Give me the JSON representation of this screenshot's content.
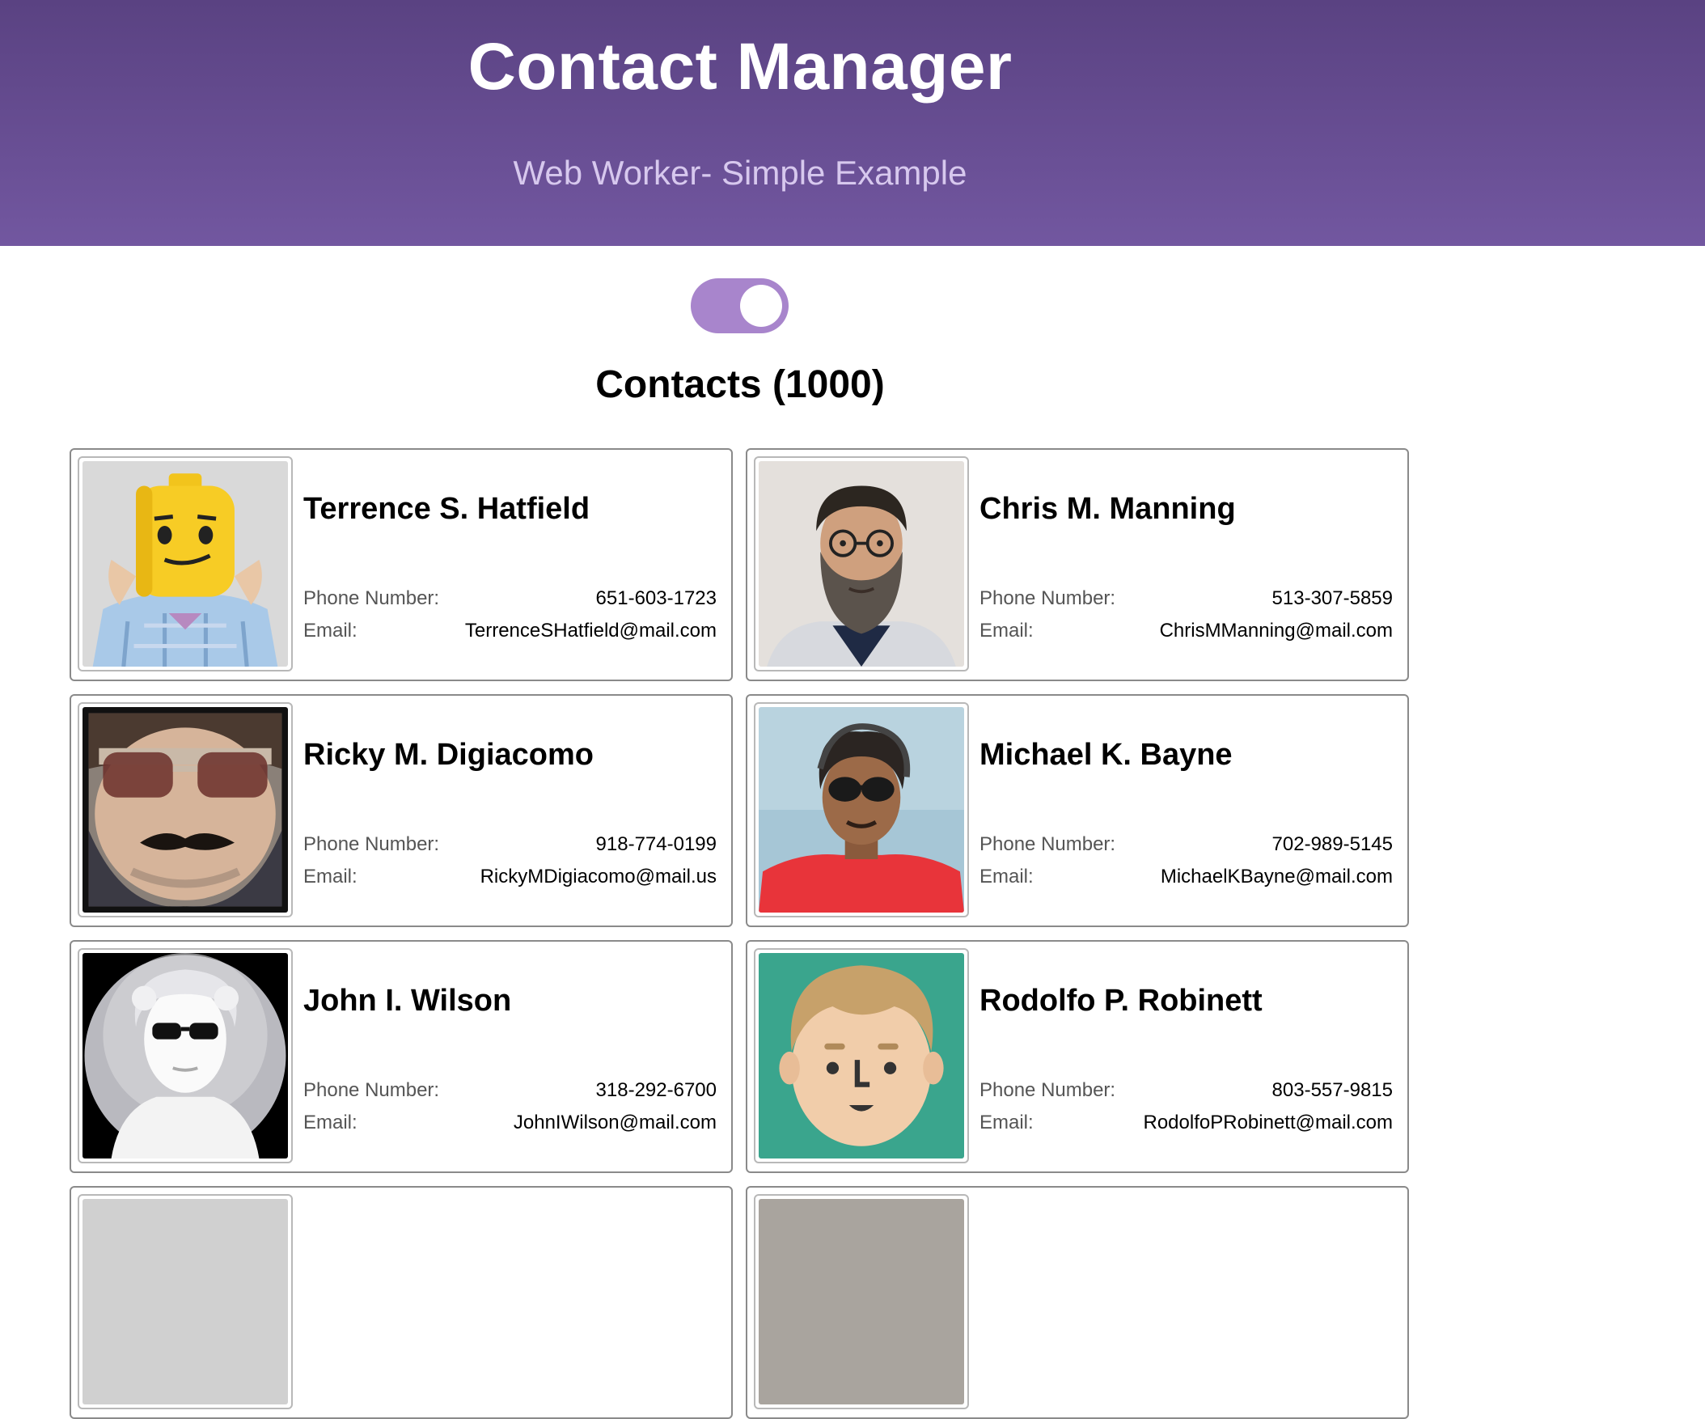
{
  "header": {
    "title": "Contact Manager",
    "subtitle": "Web Worker- Simple Example"
  },
  "toggle": {
    "state": "on",
    "color": "#a885cc"
  },
  "contacts_heading": "Contacts (1000)",
  "labels": {
    "phone": "Phone Number:",
    "email": "Email:"
  },
  "contacts": [
    {
      "name": "Terrence S. Hatfield",
      "phone": "651-603-1723",
      "email": "TerrenceSHatfield@mail.com",
      "avatar": "lego-head-avatar"
    },
    {
      "name": "Chris M. Manning",
      "phone": "513-307-5859",
      "email": "ChrisMManning@mail.com",
      "avatar": "bearded-man-avatar"
    },
    {
      "name": "Ricky M. Digiacomo",
      "phone": "918-774-0199",
      "email": "RickyMDigiacomo@mail.us",
      "avatar": "sunglasses-mustache-avatar"
    },
    {
      "name": "Michael K. Bayne",
      "phone": "702-989-5145",
      "email": "MichaelKBayne@mail.com",
      "avatar": "man-red-shirt-avatar"
    },
    {
      "name": "John I. Wilson",
      "phone": "318-292-6700",
      "email": "JohnIWilson@mail.com",
      "avatar": "statue-sunglasses-avatar"
    },
    {
      "name": "Rodolfo P. Robinett",
      "phone": "803-557-9815",
      "email": "RodolfoPRobinett@mail.com",
      "avatar": "cartoon-face-avatar"
    }
  ]
}
